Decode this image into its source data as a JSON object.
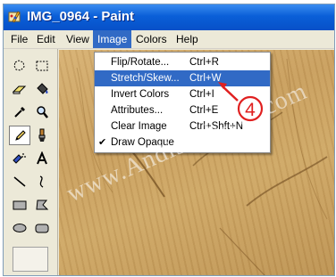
{
  "window": {
    "title": "IMG_0964 - Paint"
  },
  "menubar": {
    "items": [
      {
        "label": "File"
      },
      {
        "label": "Edit"
      },
      {
        "label": "View"
      },
      {
        "label": "Image"
      },
      {
        "label": "Colors"
      },
      {
        "label": "Help"
      }
    ],
    "active": "Image"
  },
  "image_menu": {
    "items": [
      {
        "label": "Flip/Rotate...",
        "shortcut": "Ctrl+R"
      },
      {
        "label": "Stretch/Skew...",
        "shortcut": "Ctrl+W",
        "highlighted": true
      },
      {
        "label": "Invert Colors",
        "shortcut": "Ctrl+I"
      },
      {
        "label": "Attributes...",
        "shortcut": "Ctrl+E"
      },
      {
        "label": "Clear Image",
        "shortcut": "Ctrl+Shft+N"
      },
      {
        "label": "Draw Opaque",
        "shortcut": "",
        "checked": true
      }
    ]
  },
  "toolbox": {
    "tools": [
      "free-form-select",
      "select",
      "eraser",
      "fill-with-color",
      "pick-color",
      "magnifier",
      "pencil",
      "brush",
      "airbrush",
      "text",
      "line",
      "curve",
      "rectangle",
      "polygon",
      "ellipse",
      "rounded-rectangle"
    ],
    "selected": "pencil"
  },
  "annotation": {
    "step_number": "4",
    "color": "#e02020"
  },
  "watermark": {
    "text": "www.Andisheh-No.com"
  },
  "colors": {
    "titlebar": "#0a5fd8",
    "menu_highlight": "#316ac5",
    "canvas_wood": "#c99f5e"
  }
}
